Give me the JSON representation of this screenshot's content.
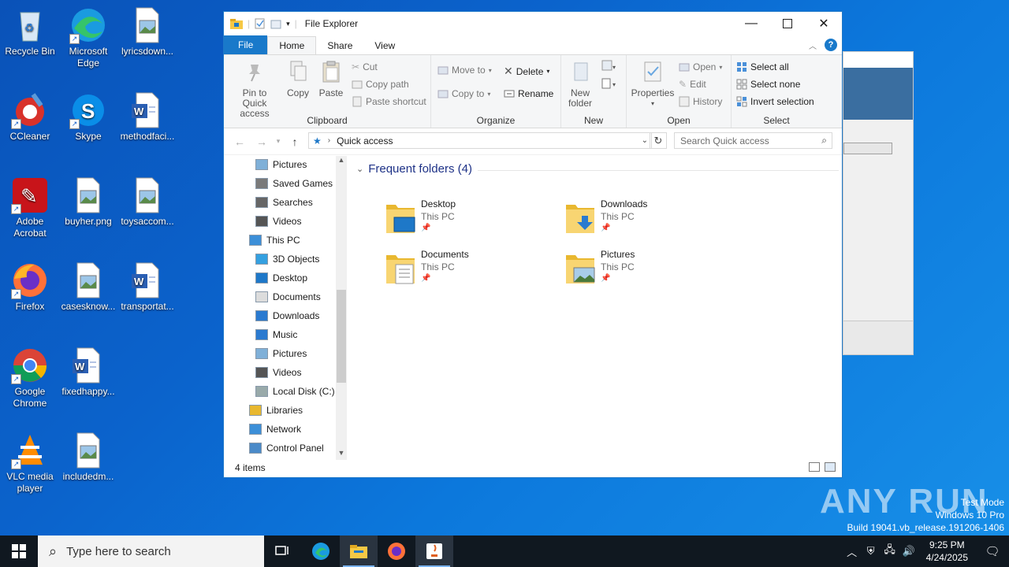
{
  "desktop": {
    "icons": [
      {
        "label": "Recycle Bin",
        "icon": "recycle-bin-icon"
      },
      {
        "label": "Microsoft Edge",
        "icon": "edge-icon"
      },
      {
        "label": "lyricsdown...",
        "icon": "image-file-icon"
      },
      {
        "label": "CCleaner",
        "icon": "ccleaner-icon"
      },
      {
        "label": "Skype",
        "icon": "skype-icon"
      },
      {
        "label": "methodfaci...",
        "icon": "word-doc-icon"
      },
      {
        "label": "Adobe Acrobat",
        "icon": "acrobat-icon"
      },
      {
        "label": "buyher.png",
        "icon": "image-file-icon"
      },
      {
        "label": "toysaccom...",
        "icon": "image-file-icon"
      },
      {
        "label": "Firefox",
        "icon": "firefox-icon"
      },
      {
        "label": "casesknow...",
        "icon": "image-file-icon"
      },
      {
        "label": "transportat...",
        "icon": "word-doc-icon"
      },
      {
        "label": "Google Chrome",
        "icon": "chrome-icon"
      },
      {
        "label": "fixedhappy...",
        "icon": "word-doc-icon"
      },
      {
        "label": "VLC media player",
        "icon": "vlc-icon"
      },
      {
        "label": "includedm...",
        "icon": "image-file-icon"
      }
    ]
  },
  "explorer": {
    "title": "File Explorer",
    "tabs": {
      "file": "File",
      "home": "Home",
      "share": "Share",
      "view": "View"
    },
    "ribbon": {
      "clipboard": {
        "label": "Clipboard",
        "pin": "Pin to Quick access",
        "copy": "Copy",
        "paste": "Paste",
        "cut": "Cut",
        "copy_path": "Copy path",
        "paste_shortcut": "Paste shortcut"
      },
      "organize": {
        "label": "Organize",
        "move_to": "Move to",
        "copy_to": "Copy to",
        "delete": "Delete",
        "rename": "Rename"
      },
      "new": {
        "label": "New",
        "new_folder": "New folder"
      },
      "open": {
        "label": "Open",
        "properties": "Properties",
        "open": "Open",
        "edit": "Edit",
        "history": "History"
      },
      "select": {
        "label": "Select",
        "select_all": "Select all",
        "select_none": "Select none",
        "invert": "Invert selection"
      }
    },
    "address": {
      "path": "Quick access",
      "search_placeholder": "Search Quick access"
    },
    "nav": [
      {
        "label": "Pictures",
        "icon": "pictures-icon",
        "indent": 1
      },
      {
        "label": "Saved Games",
        "icon": "saved-games-icon",
        "indent": 1
      },
      {
        "label": "Searches",
        "icon": "searches-icon",
        "indent": 1
      },
      {
        "label": "Videos",
        "icon": "videos-icon",
        "indent": 1
      },
      {
        "label": "This PC",
        "icon": "this-pc-icon",
        "indent": 0
      },
      {
        "label": "3D Objects",
        "icon": "3d-objects-icon",
        "indent": 1
      },
      {
        "label": "Desktop",
        "icon": "desktop-icon",
        "indent": 1
      },
      {
        "label": "Documents",
        "icon": "documents-icon",
        "indent": 1
      },
      {
        "label": "Downloads",
        "icon": "downloads-icon",
        "indent": 1
      },
      {
        "label": "Music",
        "icon": "music-icon",
        "indent": 1
      },
      {
        "label": "Pictures",
        "icon": "pictures-icon",
        "indent": 1
      },
      {
        "label": "Videos",
        "icon": "videos-icon",
        "indent": 1
      },
      {
        "label": "Local Disk (C:)",
        "icon": "local-disk-icon",
        "indent": 1
      },
      {
        "label": "Libraries",
        "icon": "libraries-icon",
        "indent": 0
      },
      {
        "label": "Network",
        "icon": "network-icon",
        "indent": 0
      },
      {
        "label": "Control Panel",
        "icon": "control-panel-icon",
        "indent": 0
      }
    ],
    "section_title": "Frequent folders (4)",
    "folders": [
      {
        "name": "Desktop",
        "location": "This PC",
        "icon": "desktop-folder-icon"
      },
      {
        "name": "Downloads",
        "location": "This PC",
        "icon": "downloads-folder-icon"
      },
      {
        "name": "Documents",
        "location": "This PC",
        "icon": "documents-folder-icon"
      },
      {
        "name": "Pictures",
        "location": "This PC",
        "icon": "pictures-folder-icon"
      }
    ],
    "status": "4 items"
  },
  "watermark": {
    "line1": "Test Mode",
    "line2": "Windows 10 Pro",
    "line3": "Build 19041.vb_release.191206-1406",
    "brand": "ANY RUN"
  },
  "taskbar": {
    "search_placeholder": "Type here to search",
    "time": "9:25 PM",
    "date": "4/24/2025"
  }
}
